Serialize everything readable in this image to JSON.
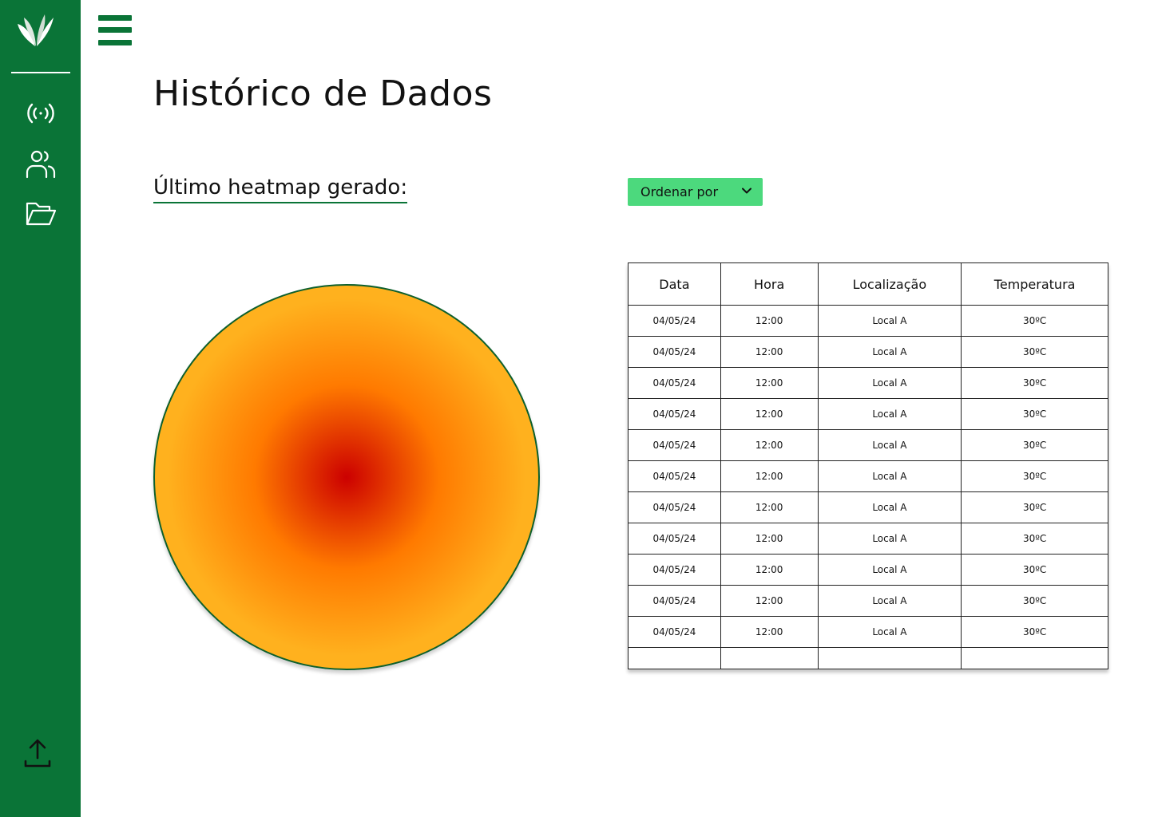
{
  "sidebar": {
    "logo_icon": "leaf-logo-icon",
    "items": [
      {
        "icon": "broadcast-icon"
      },
      {
        "icon": "users-icon"
      },
      {
        "icon": "folder-open-icon"
      }
    ],
    "footer_icon": "upload-icon",
    "color": "#0a7437"
  },
  "header": {
    "menu_icon": "hamburger-menu-icon",
    "title": "Histórico de Dados"
  },
  "heatmap": {
    "label": "Último heatmap gerado:",
    "colors": [
      "#cc0000",
      "#ff7a00",
      "#ffb11e",
      "#2f9e45"
    ]
  },
  "sort": {
    "label": "Ordenar por",
    "color": "#4cd97d"
  },
  "table": {
    "columns": [
      "Data",
      "Hora",
      "Localização",
      "Temperatura"
    ],
    "rows": [
      [
        "04/05/24",
        "12:00",
        "Local A",
        "30ºC"
      ],
      [
        "04/05/24",
        "12:00",
        "Local A",
        "30ºC"
      ],
      [
        "04/05/24",
        "12:00",
        "Local A",
        "30ºC"
      ],
      [
        "04/05/24",
        "12:00",
        "Local A",
        "30ºC"
      ],
      [
        "04/05/24",
        "12:00",
        "Local A",
        "30ºC"
      ],
      [
        "04/05/24",
        "12:00",
        "Local A",
        "30ºC"
      ],
      [
        "04/05/24",
        "12:00",
        "Local A",
        "30ºC"
      ],
      [
        "04/05/24",
        "12:00",
        "Local A",
        "30ºC"
      ],
      [
        "04/05/24",
        "12:00",
        "Local A",
        "30ºC"
      ],
      [
        "04/05/24",
        "12:00",
        "Local A",
        "30ºC"
      ],
      [
        "04/05/24",
        "12:00",
        "Local A",
        "30ºC"
      ]
    ]
  }
}
